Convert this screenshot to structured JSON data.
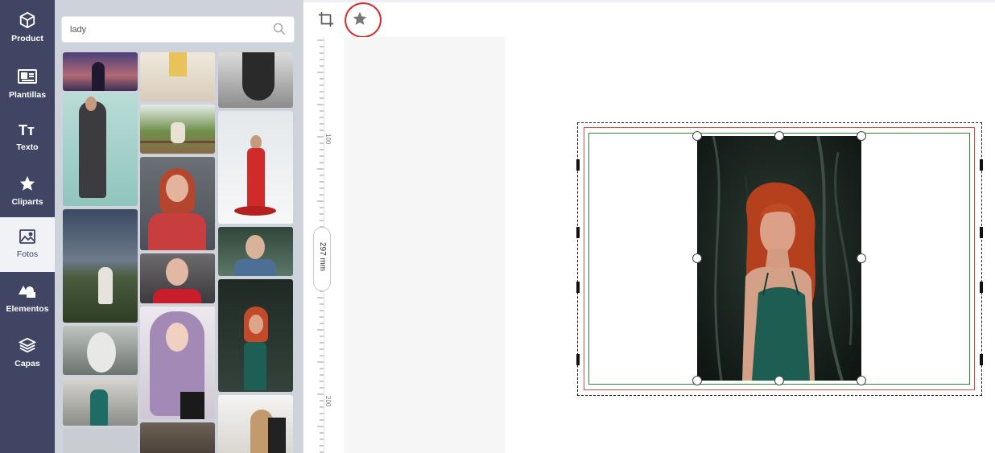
{
  "nav": {
    "items": [
      {
        "label": "Product",
        "icon": "box-icon"
      },
      {
        "label": "Plantillas",
        "icon": "id-card-icon"
      },
      {
        "label": "Texto",
        "icon": "text-icon"
      },
      {
        "label": "Cliparts",
        "icon": "star-icon"
      },
      {
        "label": "Fotos",
        "icon": "photo-icon"
      },
      {
        "label": "Elementos",
        "icon": "shapes-icon"
      },
      {
        "label": "Capas",
        "icon": "layers-icon"
      }
    ],
    "active": "Fotos"
  },
  "search": {
    "value": "lady",
    "icon": "search-icon"
  },
  "toolbar": {
    "crop_icon": "crop-icon",
    "favorite_icon": "star-icon"
  },
  "ruler": {
    "labels": [
      "100",
      "200"
    ],
    "size_label": "297 mm"
  },
  "colors": {
    "nav_bg": "#3f4562",
    "panel_bg": "#ced3db",
    "bleed": "#d84b4b",
    "safe": "#2e8b2e"
  }
}
